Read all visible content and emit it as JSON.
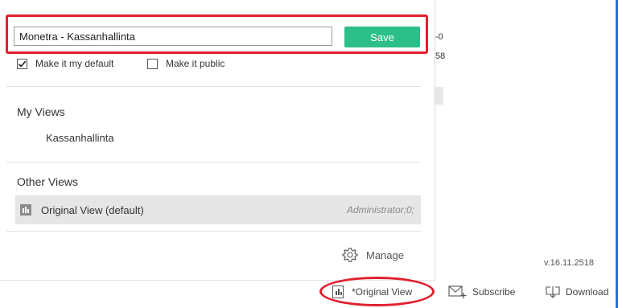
{
  "background": {
    "fragment_top": "-0",
    "fragment_second": "58"
  },
  "save_panel": {
    "view_name_value": "Monetra - Kassanhallinta",
    "save_label": "Save",
    "make_default_label": "Make it my default",
    "make_default_checked": true,
    "make_public_label": "Make it public",
    "make_public_checked": false
  },
  "my_views": {
    "title": "My Views",
    "items": [
      "Kassanhallinta"
    ]
  },
  "other_views": {
    "title": "Other Views",
    "items": [
      {
        "label": "Original View (default)",
        "owner": "Administrator;0;"
      }
    ]
  },
  "manage_label": "Manage",
  "version": "v.16.11.2518",
  "toolbar": {
    "current_view_label": "*Original View",
    "subscribe_label": "Subscribe",
    "download_label": "Download"
  },
  "colors": {
    "save_button": "#2cbf8a",
    "highlight": "#e0202e",
    "selected_row": "#e6e6e6"
  }
}
